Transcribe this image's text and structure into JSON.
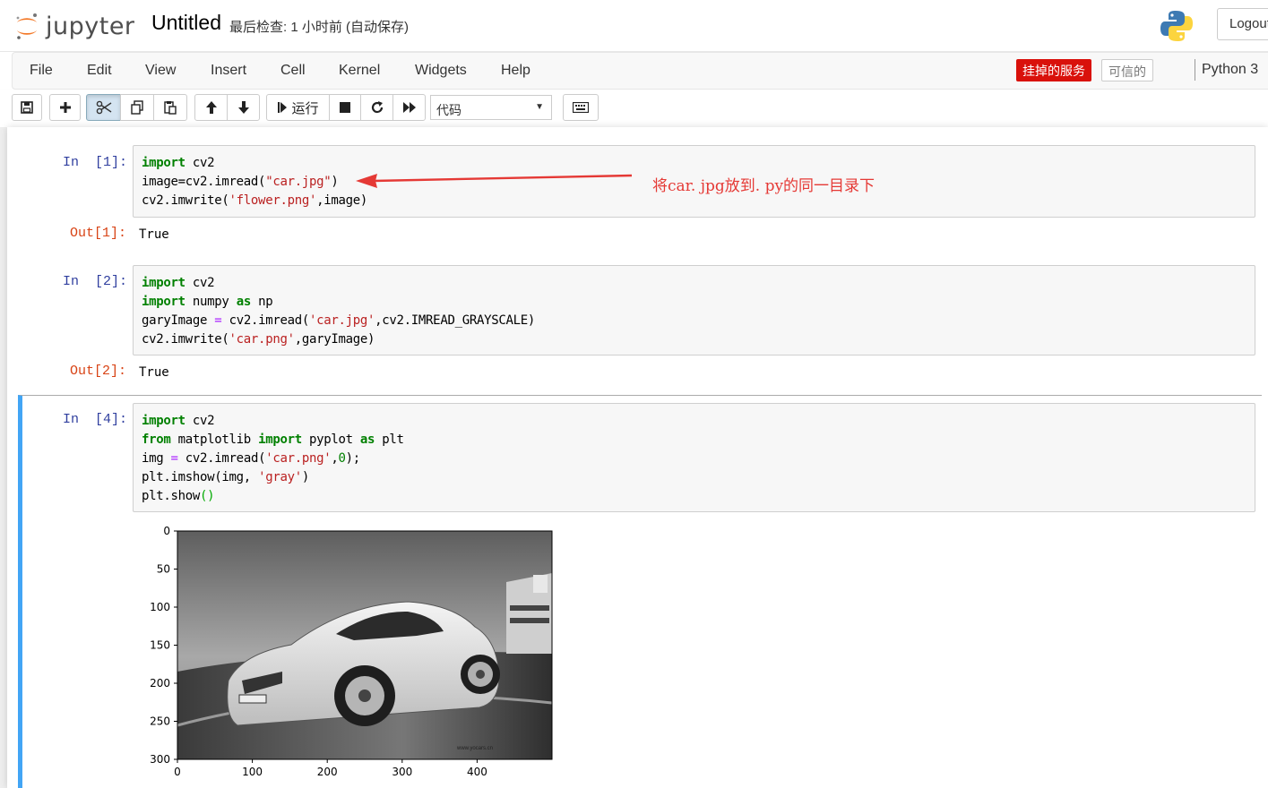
{
  "header": {
    "brand": "jupyter",
    "notebook_name": "Untitled",
    "checkpoint": "最后检查: 1 小时前  (自动保存)",
    "logout_label": "Logout"
  },
  "menubar": {
    "items": [
      "File",
      "Edit",
      "View",
      "Insert",
      "Cell",
      "Kernel",
      "Widgets",
      "Help"
    ],
    "trust_badge": "挂掉的服务",
    "trusted": "可信的",
    "kernel_name": "Python 3"
  },
  "toolbar": {
    "run_label": "运行",
    "cell_type": "代码"
  },
  "annotation": "将car. jpg放到. py的同一目录下",
  "cells": [
    {
      "in_prompt": "In  [1]:",
      "out_prompt": "Out[1]:",
      "output": "True"
    },
    {
      "in_prompt": "In  [2]:",
      "out_prompt": "Out[2]:",
      "output": "True"
    },
    {
      "in_prompt": "In  [4]:"
    }
  ],
  "chart_data": {
    "type": "image",
    "y_ticks": [
      "0",
      "50",
      "100",
      "150",
      "200",
      "250",
      "300"
    ],
    "x_ticks": [
      "0",
      "100",
      "200",
      "300",
      "400"
    ],
    "xlim": [
      0,
      500
    ],
    "ylim": [
      300,
      0
    ],
    "image_caption": "www.yocars.cn"
  },
  "colors": {
    "accent": "#42a5f5",
    "prompt_in": "#303f9f",
    "prompt_out": "#d84315",
    "annotation": "#e53935",
    "badge": "#d9110b"
  }
}
